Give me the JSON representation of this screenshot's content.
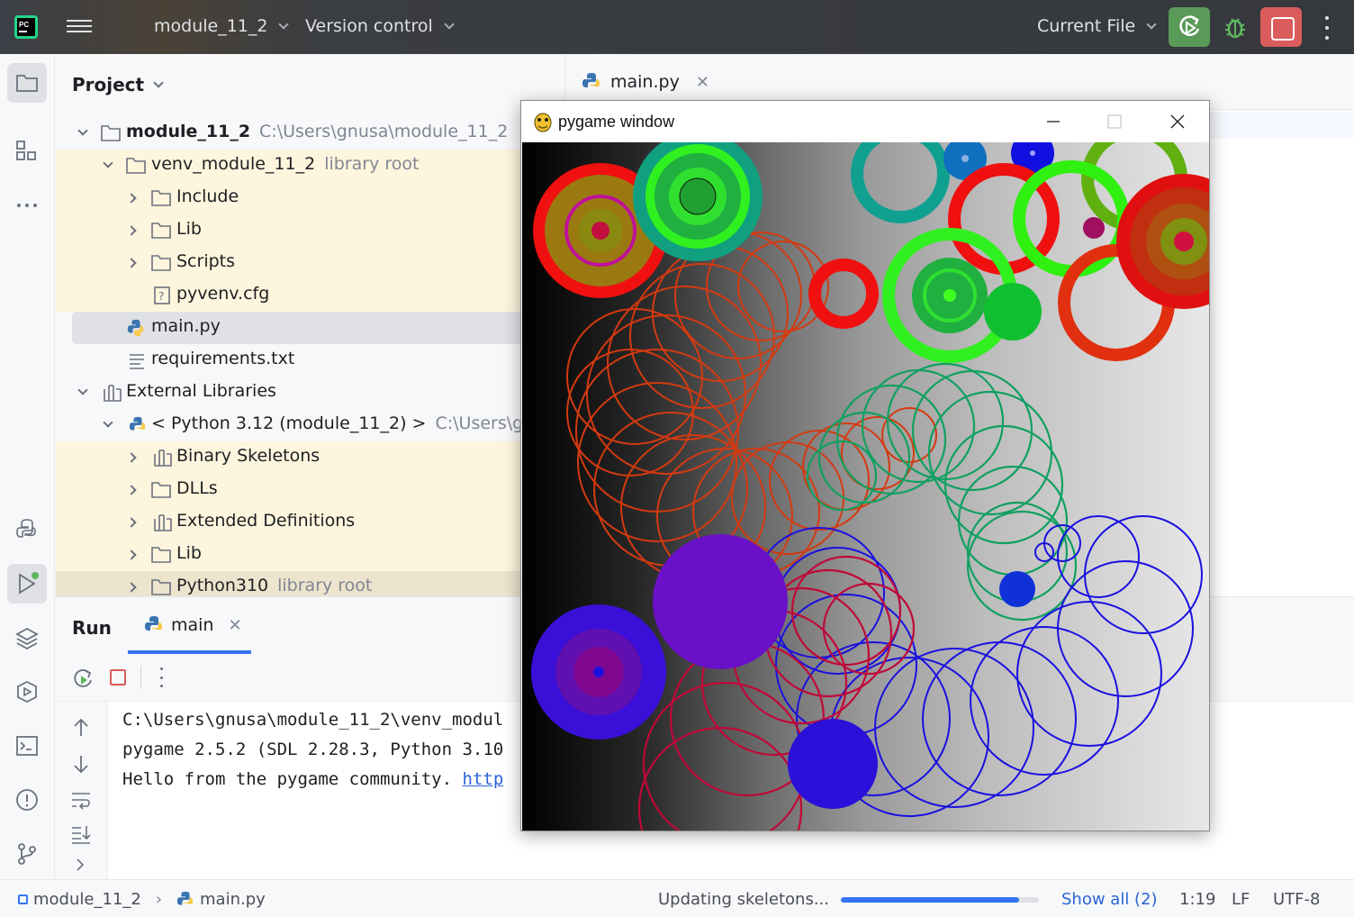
{
  "titlebar": {
    "project_name": "module_11_2",
    "vcs_label": "Version control",
    "run_config": "Current File"
  },
  "project_panel": {
    "title": "Project",
    "tree": [
      {
        "label": "module_11_2",
        "hint": "C:\\Users\\gnusa\\module_11_2"
      },
      {
        "label": "venv_module_11_2",
        "hint": "library root"
      },
      {
        "label": "Include"
      },
      {
        "label": "Lib"
      },
      {
        "label": "Scripts"
      },
      {
        "label": "pyvenv.cfg"
      },
      {
        "label": "main.py"
      },
      {
        "label": "requirements.txt"
      },
      {
        "label": "External Libraries"
      },
      {
        "label": "< Python 3.12 (module_11_2) >",
        "hint": "C:\\Users\\gnus"
      },
      {
        "label": "Binary Skeletons"
      },
      {
        "label": "DLLs"
      },
      {
        "label": "Extended Definitions"
      },
      {
        "label": "Lib"
      },
      {
        "label": "Python310",
        "hint": "library root"
      }
    ]
  },
  "editor": {
    "tab_label": "main.py"
  },
  "run_panel": {
    "title": "Run",
    "tab_label": "main",
    "console": [
      "C:\\Users\\gnusa\\module_11_2\\venv_modul",
      "pygame 2.5.2 (SDL 2.28.3, Python 3.10",
      "Hello from the pygame community. "
    ],
    "console_link": "http"
  },
  "pygame_window": {
    "title": "pygame window"
  },
  "statusbar": {
    "breadcrumb_project": "module_11_2",
    "breadcrumb_file": "main.py",
    "task": "Updating skeletons...",
    "progress": 0.9,
    "show_all": "Show all (2)",
    "position": "1:19",
    "line_sep": "LF",
    "encoding": "UTF-8"
  },
  "colors": {
    "accent": "#3574f0",
    "run_green": "#5a9a59",
    "stop_red": "#db5c5c",
    "library_bg": "#fdf5dd"
  }
}
